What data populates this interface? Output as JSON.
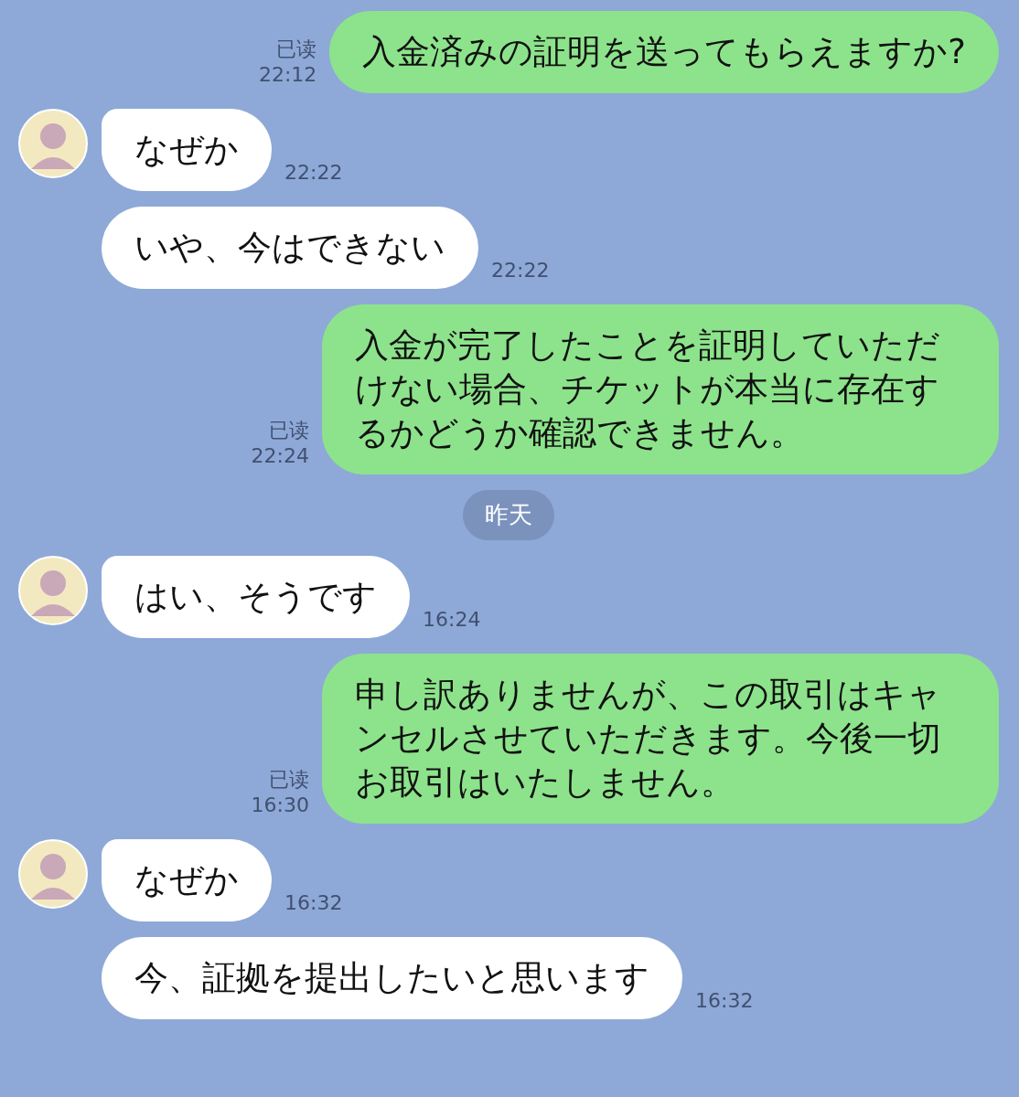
{
  "messages": [
    {
      "kind": "outgoing",
      "text": "入金済みの証明を送ってもらえますか?",
      "read_label": "已读",
      "time": "22:12"
    },
    {
      "kind": "incoming",
      "avatar": true,
      "text": "なぜか",
      "time": "22:22"
    },
    {
      "kind": "incoming",
      "avatar": false,
      "text": "いや、今はできない",
      "time": "22:22"
    },
    {
      "kind": "outgoing",
      "text": "入金が完了したことを証明していただけない場合、チケットが本当に存在するかどうか確認できません。",
      "read_label": "已读",
      "time": "22:24"
    },
    {
      "kind": "date",
      "text": "昨天"
    },
    {
      "kind": "incoming",
      "avatar": true,
      "text": "はい、そうです",
      "time": "16:24"
    },
    {
      "kind": "outgoing",
      "text": "申し訳ありませんが、この取引はキャンセルさせていただきます。今後一切お取引はいたしません。",
      "read_label": "已读",
      "time": "16:30"
    },
    {
      "kind": "incoming",
      "avatar": true,
      "text": "なぜか",
      "time": "16:32"
    },
    {
      "kind": "incoming",
      "avatar": false,
      "text": "今、証拠を提出したいと思います",
      "time": "16:32"
    }
  ]
}
